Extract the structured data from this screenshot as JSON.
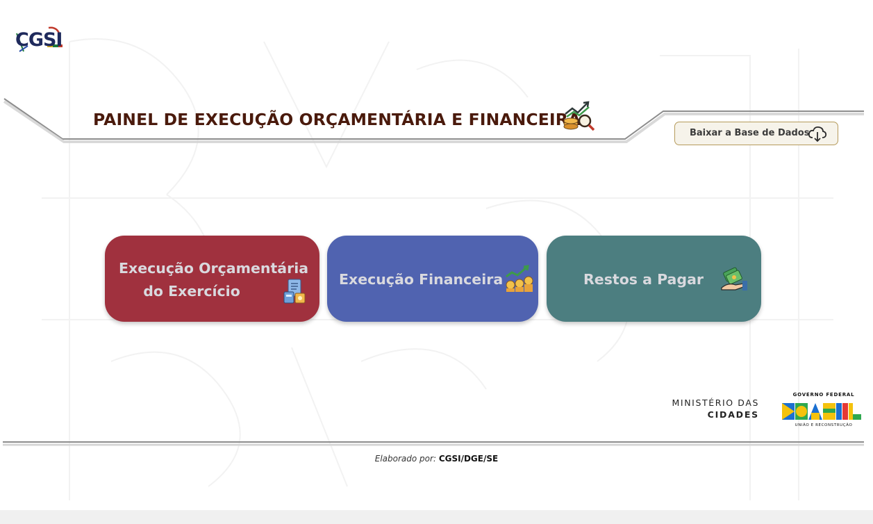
{
  "logo": {
    "text": "CGSI"
  },
  "header": {
    "title": "PAINEL DE EXECUÇÃO ORÇAMENTÁRIA E FINANCEIRA",
    "title_icon": "budget-chart-coins-icon",
    "download_button": {
      "label": "Baixar a Base de Dados",
      "icon": "cloud-download-icon"
    }
  },
  "cards": [
    {
      "line1": "Execução Orçamentária",
      "line2": "do Exercício",
      "icon": "budget-document-calculator-icon",
      "color": "#a0313e"
    },
    {
      "label": "Execução Financeira",
      "icon": "coins-growth-icon",
      "color": "#5063b0"
    },
    {
      "label": "Restos a Pagar",
      "icon": "money-hand-icon",
      "color": "#4c7e80"
    }
  ],
  "footer": {
    "ministry_line1": "MINISTÉRIO DAS",
    "ministry_line2": "CIDADES",
    "gov_logo": {
      "top": "GOVERNO FEDERAL",
      "word": "BRASIL",
      "bottom": "UNIÃO E RECONSTRUÇÃO"
    },
    "credit_prefix": "Elaborado por:",
    "credit_org": "CGSI/DGE/SE"
  },
  "colors": {
    "title": "#4a1a0c",
    "button_border": "#b59a5a"
  }
}
